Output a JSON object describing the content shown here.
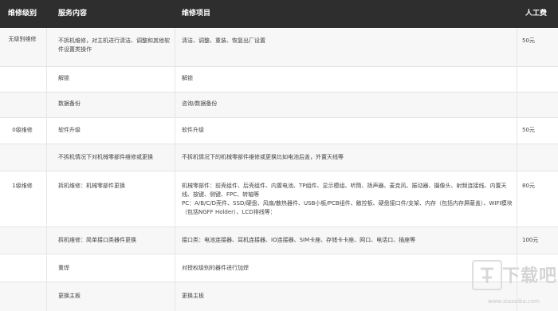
{
  "header": {
    "level": "维修级别",
    "service": "服务内容",
    "item": "维修项目",
    "fee": "人工费"
  },
  "rows": [
    {
      "level": "无级别维修",
      "service": "不拆机维修，对主机进行清洁、调整和其他软件设置类操作",
      "item": "清洁、调整、重装、恢复出厂设置",
      "fee": "50元"
    },
    {
      "level": "",
      "service": "解锁",
      "item": "解锁",
      "fee": ""
    },
    {
      "level": "",
      "service": "数据备份",
      "item": "咨询/数据备份",
      "fee": ""
    },
    {
      "level": "0级维修",
      "service": "软件升级",
      "item": "软件升级",
      "fee": "50元"
    },
    {
      "level": "",
      "service": "不拆机情况下对机械零部件维修或更换",
      "item": "不拆机情况下的机械零部件维修或更换比如电池后盖，外置天线等",
      "fee": ""
    },
    {
      "level": "1级维修",
      "service": "拆机维修：机械零部件更换",
      "item": "机械零部件：前壳组件、后壳组件、内置电池、TP组件、显示模组、听筒、扬声器、麦克风、振动器、摄像头、射频连接线、内置天线、按键、侧键、FPC、转轴等\nPC：A/B/C/D壳件、SSD/硬盘、风扇/散热器件、USB小板/PCB组件、触控板、硬盘接口件/支架、内存（包括内存屏蔽盖）、WIFI模块（包括NGFF Holder）、LCD排线等：",
      "fee": "80元"
    },
    {
      "level": "",
      "service": "拆机维修：简单接口类器件更换",
      "item": "接口类：电池连接器、耳机连接器、IO连接器、SIM卡座、存储卡卡座、网口、电话口、插座等",
      "fee": "100元"
    },
    {
      "level": "",
      "service": "重焊",
      "item": "对授权级别的器件进行加焊",
      "fee": ""
    },
    {
      "level": "",
      "service": "更换主板",
      "item": "更换主板",
      "fee": ""
    }
  ],
  "watermark": {
    "text": "下载吧",
    "url": "www.xiazaiba.com"
  },
  "colors": {
    "header_bg": "#2e2e2e",
    "header_text": "#ffffff",
    "alt_row_bg": "#f7f7f7",
    "border": "#e4e4e4"
  }
}
